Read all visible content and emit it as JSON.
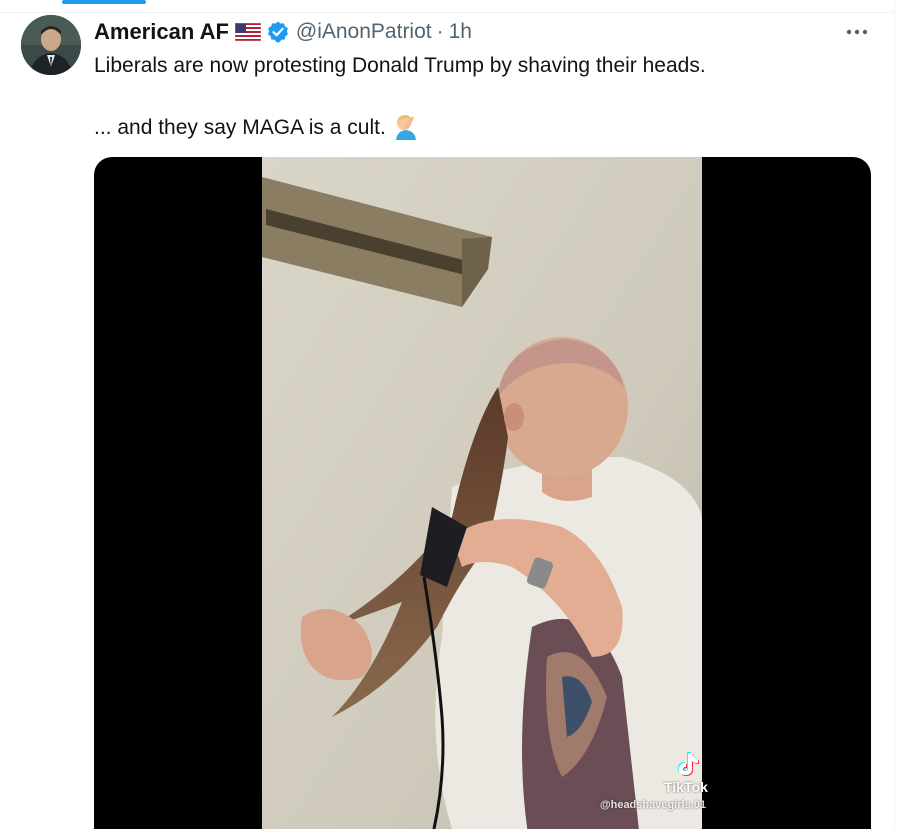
{
  "tweet": {
    "display_name": "American AF",
    "handle": "@iAnonPatriot",
    "separator": "·",
    "timestamp": "1h",
    "text_line_1": "Liberals are now protesting Donald Trump by shaving their heads.",
    "text_line_2": "... and they say MAGA is a cult.",
    "icons": {
      "flag": "us-flag-icon",
      "verified": "verified-badge-icon",
      "more": "more-options-icon",
      "emoji": "man-facepalming-emoji"
    }
  },
  "media": {
    "watermark_brand": "TikTok",
    "watermark_user": "@headshavegirls.01"
  },
  "colors": {
    "accent": "#1d9bf0",
    "text_primary": "#0f1419",
    "text_secondary": "#536471",
    "media_background": "#000000"
  }
}
